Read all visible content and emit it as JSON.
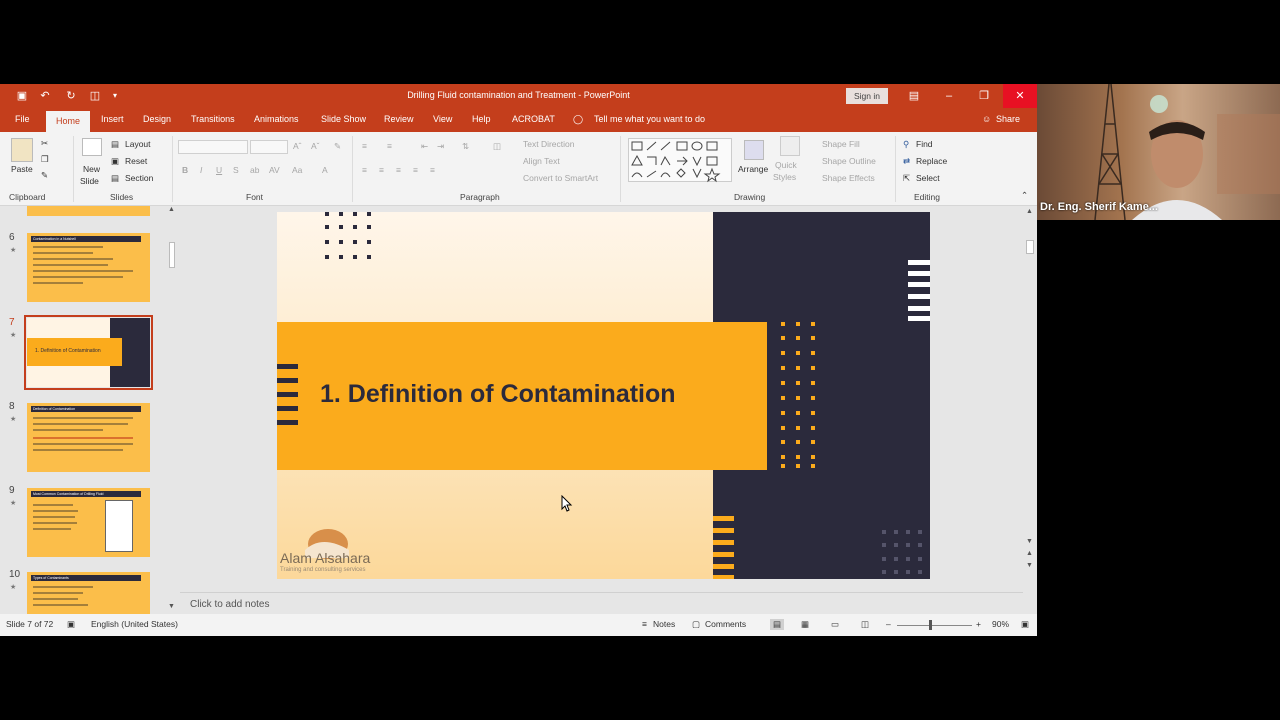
{
  "window": {
    "title": "Drilling Fluid contamination and Treatment  -  PowerPoint",
    "sign_in": "Sign in"
  },
  "menu": {
    "tabs": [
      "File",
      "Home",
      "Insert",
      "Design",
      "Transitions",
      "Animations",
      "Slide Show",
      "Review",
      "View",
      "Help",
      "ACROBAT"
    ],
    "tell_me": "Tell me what you want to do",
    "share": "Share"
  },
  "ribbon": {
    "clipboard": {
      "paste": "Paste",
      "label": "Clipboard"
    },
    "slides": {
      "new_slide_1": "New",
      "new_slide_2": "Slide",
      "layout": "Layout",
      "reset": "Reset",
      "section": "Section",
      "label": "Slides"
    },
    "font": {
      "label": "Font"
    },
    "paragraph": {
      "text_direction": "Text Direction",
      "align_text": "Align Text",
      "convert": "Convert to SmartArt",
      "label": "Paragraph"
    },
    "drawing": {
      "arrange": "Arrange",
      "quick_styles_1": "Quick",
      "quick_styles_2": "Styles",
      "shape_fill": "Shape Fill",
      "shape_outline": "Shape Outline",
      "shape_effects": "Shape Effects",
      "label": "Drawing"
    },
    "editing": {
      "find": "Find",
      "replace": "Replace",
      "select": "Select",
      "label": "Editing"
    }
  },
  "thumbnails": [
    {
      "num": "6",
      "title": "Contamination in a Nutshell"
    },
    {
      "num": "7",
      "title": "1. Definition of Contamination"
    },
    {
      "num": "8",
      "title": "Definition of Contamination"
    },
    {
      "num": "9",
      "title": "Most Common Contamination of Drilling Fluid"
    },
    {
      "num": "10",
      "title": "Types of Contaminants"
    }
  ],
  "slide": {
    "title": "1. Definition of Contamination",
    "logo": "Alam Alsahara",
    "logo_sub": "Training and consulting services"
  },
  "notes": {
    "placeholder": "Click to add notes"
  },
  "status": {
    "slide_of": "Slide 7 of 72",
    "language": "English (United States)",
    "notes": "Notes",
    "comments": "Comments",
    "zoom": "90%"
  },
  "webcam": {
    "name": "Dr. Eng. Sherif Kame..."
  },
  "colors": {
    "accent": "#c43e1c",
    "slide_orange": "#fbab1c",
    "slide_dark": "#2b2a3c"
  }
}
